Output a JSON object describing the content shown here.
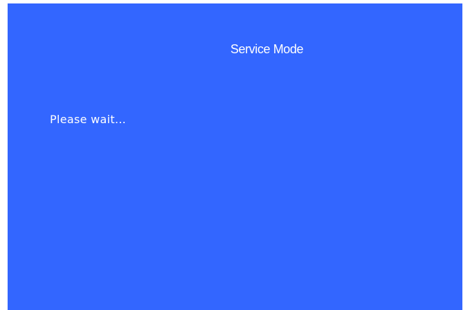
{
  "screen": {
    "title": "Service Mode",
    "message": "Please wait…",
    "background_color": "#3366ff",
    "text_color": "#ffffff"
  }
}
